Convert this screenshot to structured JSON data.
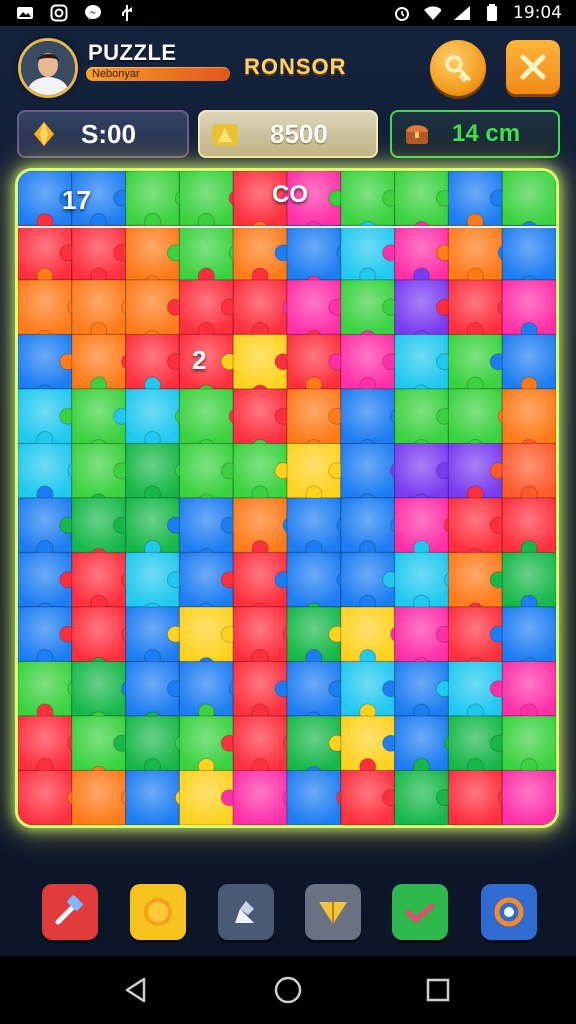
{
  "status_bar": {
    "time": "19:04",
    "icons": [
      "image-icon",
      "instagram-icon",
      "messenger-icon",
      "usb-icon",
      "alarm-icon",
      "wifi-icon",
      "signal-icon",
      "battery-icon"
    ]
  },
  "header": {
    "title": "PUZZLE",
    "subtitle": "Nebonyar",
    "player_name": "RONSOR",
    "hint_button_icon": "key-icon",
    "close_button_icon": "close-icon"
  },
  "stats": {
    "time": "S:00",
    "time_icon": "gem-icon",
    "score": "8500",
    "score_icon": "crown-icon",
    "moves": "14 cm",
    "moves_icon": "chest-icon"
  },
  "board": {
    "labels": [
      "17",
      "CO",
      "2"
    ],
    "glow_color": "#d9ff6a"
  },
  "tools": [
    {
      "name": "hammer-tool",
      "icon": "hammer-icon",
      "color": "#e23b3b"
    },
    {
      "name": "coin-tool",
      "icon": "coin-icon",
      "color": "#f6c21d"
    },
    {
      "name": "pencil-tool",
      "icon": "pencil-icon",
      "color": "#4a5a74"
    },
    {
      "name": "arrow-tool",
      "icon": "arrow-icon",
      "color": "#6a7182"
    },
    {
      "name": "check-tool",
      "icon": "check-icon",
      "color": "#2fb84b"
    },
    {
      "name": "swirl-tool",
      "icon": "swirl-icon",
      "color": "#2f6bd0"
    }
  ],
  "nav": [
    "back-icon",
    "home-icon",
    "recents-icon"
  ]
}
